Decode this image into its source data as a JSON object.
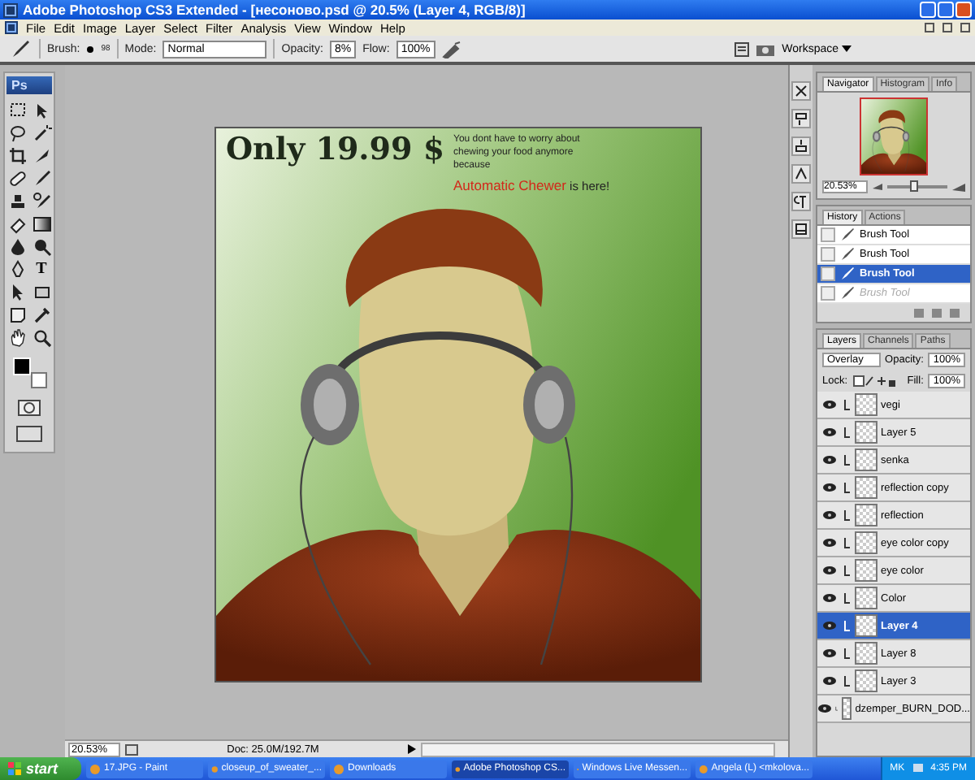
{
  "window": {
    "title": "Adobe Photoshop CS3 Extended - [несоново.psd @ 20.5% (Layer 4, RGB/8)]"
  },
  "menu": [
    "File",
    "Edit",
    "Image",
    "Layer",
    "Select",
    "Filter",
    "Analysis",
    "View",
    "Window",
    "Help"
  ],
  "options_bar": {
    "brush_label": "Brush:",
    "brush_size": "98",
    "mode_label": "Mode:",
    "mode": "Normal",
    "opacity_label": "Opacity:",
    "opacity": "8%",
    "flow_label": "Flow:",
    "flow": "100%",
    "workspace": "Workspace"
  },
  "toolbox": {
    "logo": "Ps",
    "type_tool": "T"
  },
  "document": {
    "headline": "Only 19.99 $",
    "blurb": "You dont have to worry about chewing your food anymore because",
    "highlight": "Automatic Chewer",
    "tail": "is here!"
  },
  "status_bar": {
    "zoom": "20.53%",
    "doc": "Doc: 25.0M/192.7M"
  },
  "navigator": {
    "tabs": [
      {
        "label": "Navigator",
        "selected": true
      },
      {
        "label": "Histogram",
        "selected": false
      },
      {
        "label": "Info",
        "selected": false
      }
    ],
    "zoom": "20.53%",
    "level": 0.45
  },
  "history": {
    "tabs": [
      {
        "label": "History",
        "selected": true
      },
      {
        "label": "Actions",
        "selected": false
      }
    ],
    "items": [
      {
        "label": "Brush Tool",
        "selected": false,
        "dimmed": false
      },
      {
        "label": "Brush Tool",
        "selected": false,
        "dimmed": false
      },
      {
        "label": "Brush Tool",
        "selected": true,
        "dimmed": false
      },
      {
        "label": "Brush Tool",
        "selected": false,
        "dimmed": true
      }
    ]
  },
  "layers": {
    "tabs": [
      {
        "label": "Layers",
        "selected": true
      },
      {
        "label": "Channels",
        "selected": false
      },
      {
        "label": "Paths",
        "selected": false
      }
    ],
    "blend_mode": "Overlay",
    "opacity_label": "Opacity:",
    "opacity": "100%",
    "lock_label": "Lock:",
    "fill_label": "Fill:",
    "fill": "100%",
    "items": [
      {
        "name": "vegi",
        "selected": false
      },
      {
        "name": "Layer 5",
        "selected": false
      },
      {
        "name": "senka",
        "selected": false
      },
      {
        "name": "reflection copy",
        "selected": false
      },
      {
        "name": "reflection",
        "selected": false
      },
      {
        "name": "eye color copy",
        "selected": false
      },
      {
        "name": "eye color",
        "selected": false
      },
      {
        "name": "Color",
        "selected": false
      },
      {
        "name": "Layer 4",
        "selected": true
      },
      {
        "name": "Layer 8",
        "selected": false
      },
      {
        "name": "Layer 3",
        "selected": false
      },
      {
        "name": "dzemper_BURN_DOD...",
        "selected": false
      }
    ]
  },
  "taskbar": {
    "start": "start",
    "tasks": [
      {
        "label": "17.JPG - Paint",
        "selected": false
      },
      {
        "label": "closeup_of_sweater_...",
        "selected": false
      },
      {
        "label": "Downloads",
        "selected": false
      },
      {
        "label": "Adobe Photoshop CS...",
        "selected": true
      },
      {
        "label": "Windows Live Messen...",
        "selected": false
      },
      {
        "label": "Angela (L) <mkolova...",
        "selected": false
      }
    ],
    "language": "MK",
    "clock": "4:35 PM"
  }
}
